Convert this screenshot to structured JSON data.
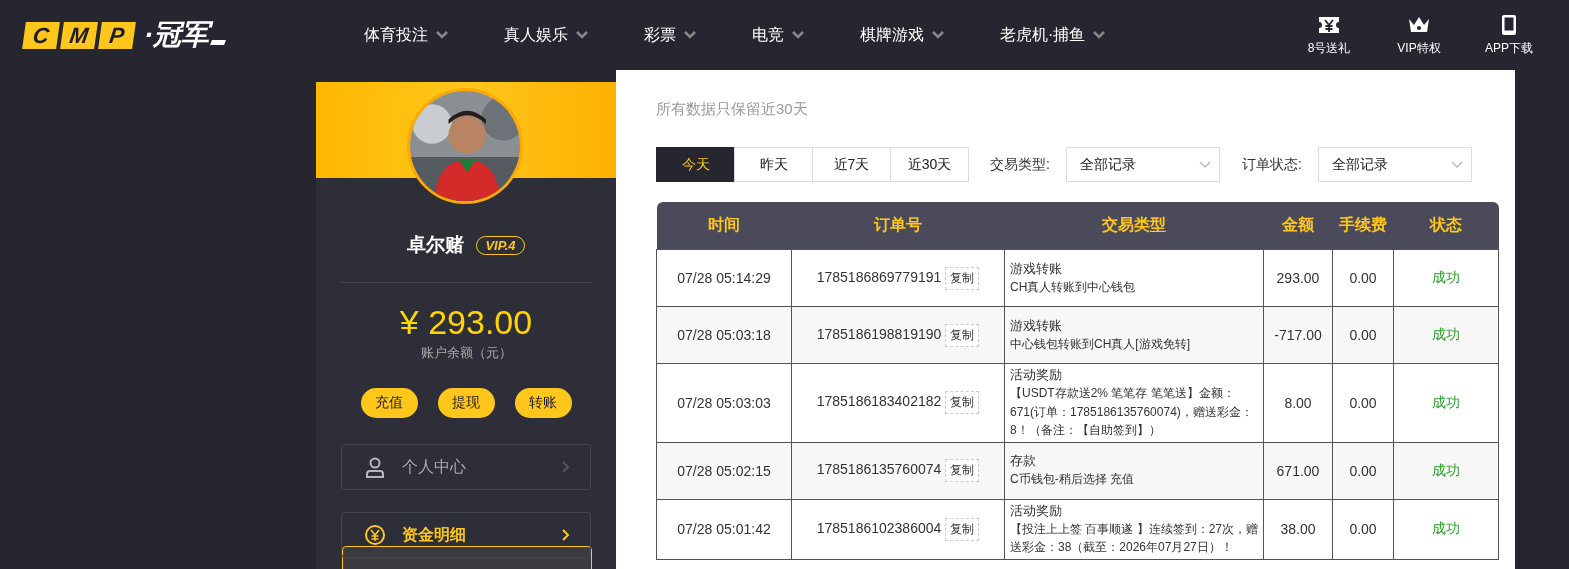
{
  "logo": {
    "letters": [
      "C",
      "M",
      "P"
    ],
    "name": "·冠军"
  },
  "nav": [
    {
      "label": "体育投注"
    },
    {
      "label": "真人娱乐"
    },
    {
      "label": "彩票"
    },
    {
      "label": "电竞"
    },
    {
      "label": "棋牌游戏"
    },
    {
      "label": "老虎机·捕鱼"
    }
  ],
  "header_links": [
    {
      "kind": "ticket",
      "label": "8号送礼"
    },
    {
      "kind": "crown",
      "label": "VIP特权"
    },
    {
      "kind": "phone",
      "label": "APP下载"
    }
  ],
  "profile": {
    "username": "卓尔赌",
    "vip": "VIP.4",
    "balance": "¥ 293.00",
    "balance_label": "账户余额（元）",
    "actions": [
      "充值",
      "提现",
      "转账"
    ]
  },
  "sidebar": {
    "items": [
      {
        "kind": "user",
        "label": "个人中心",
        "selected": false
      },
      {
        "kind": "yen",
        "label": "资金明细",
        "selected": true
      }
    ]
  },
  "notice": "所有数据只保留近30天",
  "date_tabs": [
    {
      "label": "今天",
      "selected": true
    },
    {
      "label": "昨天",
      "selected": false
    },
    {
      "label": "近7天",
      "selected": false
    },
    {
      "label": "近30天",
      "selected": false
    }
  ],
  "filters": [
    {
      "label": "交易类型:",
      "value": "全部记录"
    },
    {
      "label": "订单状态:",
      "value": "全部记录"
    }
  ],
  "table": {
    "columns": [
      "时间",
      "订单号",
      "交易类型",
      "金额",
      "手续费",
      "状态"
    ],
    "rows": [
      {
        "time": "07/28 05:14:29",
        "order": "1785186869779191",
        "copy_label": "复制",
        "type": "游戏转账",
        "detail": "CH真人转账到中心钱包",
        "amount": "293.00",
        "fee": "0.00",
        "status": "成功"
      },
      {
        "time": "07/28 05:03:18",
        "order": "1785186198819190",
        "copy_label": "复制",
        "type": "游戏转账",
        "detail": "中心钱包转账到CH真人[游戏免转]",
        "amount": "-717.00",
        "fee": "0.00",
        "status": "成功"
      },
      {
        "time": "07/28 05:03:03",
        "order": "1785186183402182",
        "copy_label": "复制",
        "type": "活动奖励",
        "detail": "【USDT存款送2% 笔笔存 笔笔送】金额：671(订单：1785186135760074)，赠送彩金：8！（备注：【自助签到】）",
        "amount": "8.00",
        "fee": "0.00",
        "status": "成功"
      },
      {
        "time": "07/28 05:02:15",
        "order": "1785186135760074",
        "copy_label": "复制",
        "type": "存款",
        "detail": "C币钱包-稍后选择 充值",
        "amount": "671.00",
        "fee": "0.00",
        "status": "成功"
      },
      {
        "time": "07/28 05:01:42",
        "order": "1785186102386004",
        "copy_label": "复制",
        "type": "活动奖励",
        "detail": "【投注上上签 百事顺遂 】连续签到：27次，赠送彩金：38（截至：2026年07月27日）！",
        "amount": "38.00",
        "fee": "0.00",
        "status": "成功"
      }
    ]
  }
}
